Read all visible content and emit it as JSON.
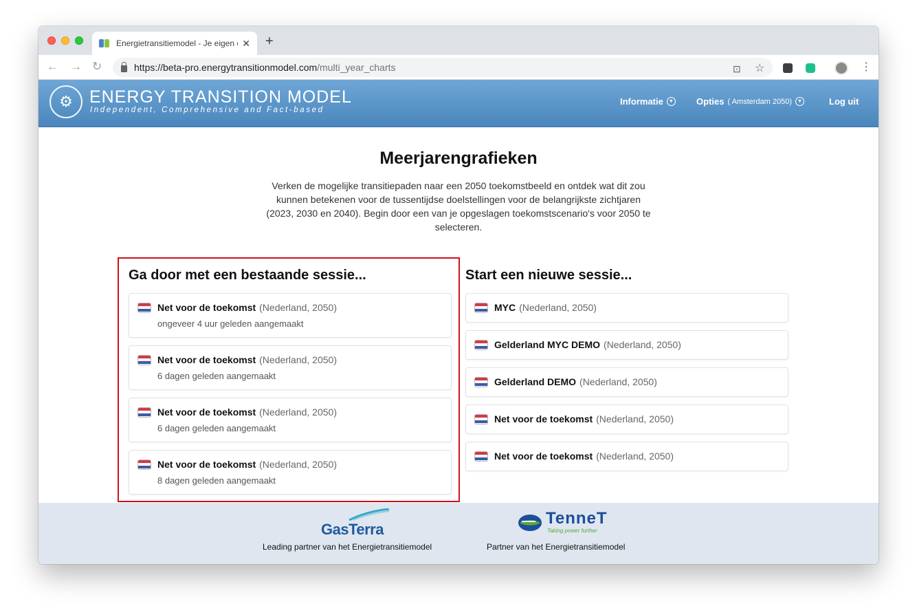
{
  "browser": {
    "tab_title": "Energietransitiemodel - Je eigen energietoekomst",
    "new_tab": "+",
    "url_host": "https://beta-pro.energytransitionmodel.com",
    "url_path": "/multi_year_charts"
  },
  "site": {
    "logo_title": "ENERGY TRANSITION MODEL",
    "logo_subtitle": "Independent, Comprehensive and Fact-based",
    "nav": {
      "informatie": "Informatie",
      "opties": "Opties",
      "opties_context": "( Amsterdam 2050)",
      "logout": "Log uit"
    }
  },
  "main": {
    "title": "Meerjarengrafieken",
    "intro": "Verken de mogelijke transitiepaden naar een 2050 toekomstbeeld en ontdek wat dit zou kunnen betekenen voor de tussentijdse doelstellingen voor de belangrijkste zichtjaren (2023, 2030 en 2040). Begin door een van je opgeslagen toekomstscenario's voor 2050 te selecteren.",
    "existing_heading": "Ga door met een bestaande sessie...",
    "new_heading": "Start een nieuwe sessie...",
    "existing_sessions": [
      {
        "name": "Net voor de toekomst",
        "meta": "(Nederland, 2050)",
        "date": "ongeveer 4 uur geleden aangemaakt"
      },
      {
        "name": "Net voor de toekomst",
        "meta": "(Nederland, 2050)",
        "date": "6 dagen geleden aangemaakt"
      },
      {
        "name": "Net voor de toekomst",
        "meta": "(Nederland, 2050)",
        "date": "6 dagen geleden aangemaakt"
      },
      {
        "name": "Net voor de toekomst",
        "meta": "(Nederland, 2050)",
        "date": "8 dagen geleden aangemaakt"
      }
    ],
    "new_sessions": [
      {
        "name": "MYC",
        "meta": "(Nederland, 2050)"
      },
      {
        "name": "Gelderland MYC DEMO",
        "meta": "(Nederland, 2050)"
      },
      {
        "name": "Gelderland DEMO",
        "meta": "(Nederland, 2050)"
      },
      {
        "name": "Net voor de toekomst",
        "meta": "(Nederland, 2050)"
      },
      {
        "name": "Net voor de toekomst",
        "meta": "(Nederland, 2050)"
      }
    ]
  },
  "footer": {
    "gasterra_logo": "GasTerra",
    "gasterra_caption": "Leading partner van het Energietransitiemodel",
    "tennet_logo": "TenneT",
    "tennet_tagline": "Taking power further",
    "tennet_caption": "Partner van het Energietransitiemodel"
  },
  "colors": {
    "header_blue": "#4a86bd",
    "highlight_red": "#d0111a",
    "footer_bg": "#dfe6f0"
  }
}
